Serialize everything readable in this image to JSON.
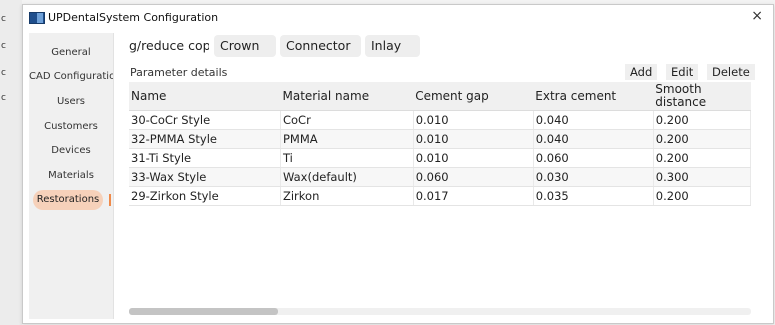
{
  "window": {
    "title": "UPDentalSystem Configuration",
    "close_glyph": "×"
  },
  "backdrop": {
    "edge_glyphs": [
      "c",
      "c",
      "c",
      "c"
    ]
  },
  "sidebar": {
    "items": [
      {
        "label": "General"
      },
      {
        "label": "CAD Configuratio"
      },
      {
        "label": "Users"
      },
      {
        "label": "Customers"
      },
      {
        "label": "Devices"
      },
      {
        "label": "Materials"
      },
      {
        "label": "Restorations"
      }
    ],
    "active_index": 6
  },
  "tabs": [
    {
      "label": "g/reduce coping pon"
    },
    {
      "label": "Crown"
    },
    {
      "label": "Connector"
    },
    {
      "label": "Inlay"
    }
  ],
  "section": {
    "label": "Parameter details"
  },
  "actions": {
    "add": "Add",
    "edit": "Edit",
    "delete": "Delete"
  },
  "table": {
    "columns": [
      "Name",
      "Material name",
      "Cement gap",
      "Extra cement",
      "Smooth distance"
    ],
    "rows": [
      [
        "30-CoCr Style",
        "CoCr",
        "0.010",
        "0.040",
        "0.200"
      ],
      [
        "32-PMMA Style",
        "PMMA",
        "0.010",
        "0.040",
        "0.200"
      ],
      [
        "31-Ti Style",
        "Ti",
        "0.010",
        "0.060",
        "0.200"
      ],
      [
        "33-Wax Style",
        "Wax(default)",
        "0.060",
        "0.030",
        "0.300"
      ],
      [
        "29-Zirkon Style",
        "Zirkon",
        "0.017",
        "0.035",
        "0.200"
      ]
    ]
  },
  "scrollbar": {
    "position_fraction": 0.0,
    "visible_fraction": 0.24
  },
  "colors": {
    "active_nav_bg": "#f6d1ba",
    "active_nav_marker": "#ef8a4a"
  }
}
